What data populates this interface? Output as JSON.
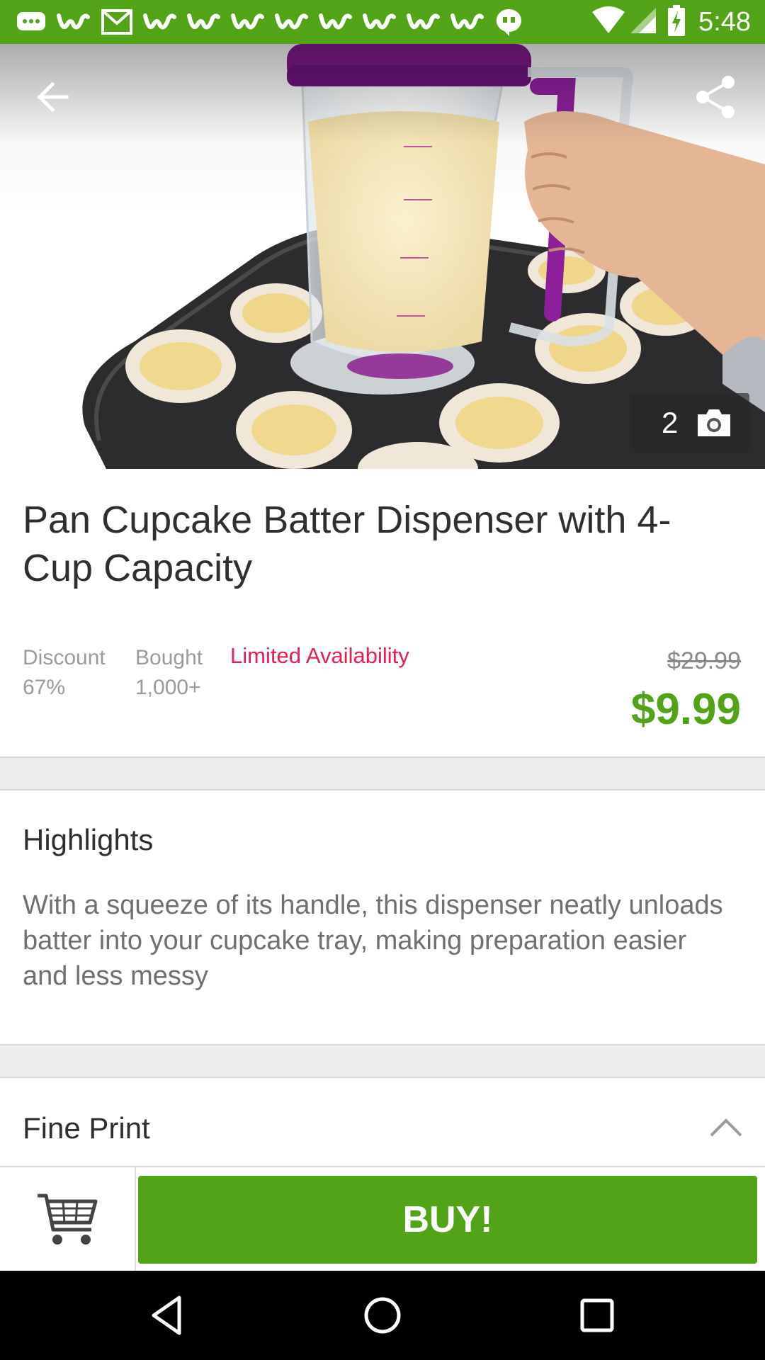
{
  "status_bar": {
    "time": "5:48",
    "notification_icons": [
      "chat-bubble-icon",
      "groupon-icon",
      "gmail-icon",
      "groupon-icon",
      "groupon-icon",
      "groupon-icon",
      "groupon-icon",
      "groupon-icon",
      "groupon-icon",
      "groupon-icon",
      "groupon-icon",
      "hangouts-icon"
    ],
    "system_icons": [
      "wifi-icon",
      "signal-icon",
      "battery-charging-icon"
    ]
  },
  "header": {
    "back_icon": "arrow-back-icon",
    "share_icon": "share-icon"
  },
  "hero": {
    "photo_count": "2",
    "camera_icon": "camera-icon"
  },
  "product": {
    "title": "Pan Cupcake Batter Dispenser with 4-Cup Capacity",
    "discount_label": "Discount",
    "discount_value": "67%",
    "bought_label": "Bought",
    "bought_value": "1,000+",
    "availability": "Limited Availability",
    "original_price": "$29.99",
    "price": "$9.99"
  },
  "highlights": {
    "title": "Highlights",
    "text": "With a squeeze of its handle, this dispenser neatly unloads batter into your cupcake tray, making preparation easier and less messy"
  },
  "fine_print": {
    "title": "Fine Print",
    "icon": "chevron-up-icon"
  },
  "actions": {
    "cart_icon": "shopping-cart-icon",
    "buy_label": "BUY!"
  },
  "colors": {
    "brand_green": "#53a318",
    "limited_red": "#e6204f"
  }
}
